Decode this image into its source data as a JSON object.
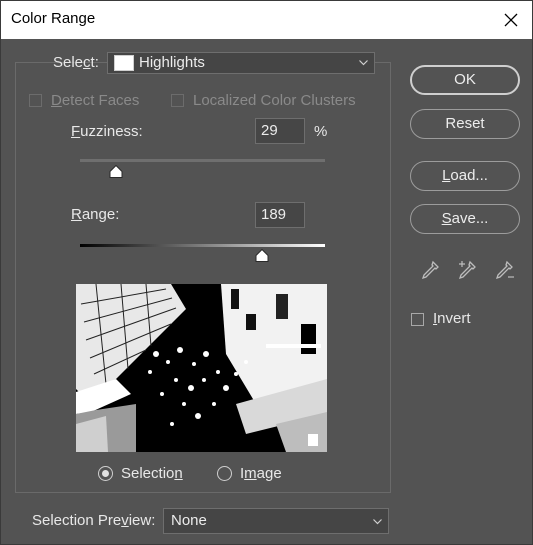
{
  "window": {
    "title": "Color Range"
  },
  "select": {
    "prefix": "Sele",
    "accel": "c",
    "suffix": "t:",
    "value": "Highlights"
  },
  "detect_faces": {
    "pre": "",
    "accel": "D",
    "post": "etect Faces",
    "checked": false,
    "enabled": false
  },
  "localized": {
    "label": "Localized Color Clusters",
    "checked": false,
    "enabled": false
  },
  "fuzziness": {
    "accel": "F",
    "rest": "uzziness:",
    "value": "29",
    "unit": "%"
  },
  "range": {
    "accel": "R",
    "rest": "ange:",
    "value": "189"
  },
  "buttons": {
    "ok": "OK",
    "reset": "Reset",
    "load": {
      "accel": "L",
      "rest": "oad..."
    },
    "save": {
      "accel": "S",
      "rest": "ave..."
    }
  },
  "eyedroppers": [
    "eyedropper-icon",
    "eyedropper-add-icon",
    "eyedropper-subtract-icon"
  ],
  "invert": {
    "accel": "I",
    "rest": "nvert",
    "checked": false
  },
  "view_mode": {
    "selection": {
      "pre": "Selectio",
      "accel": "n",
      "post": "",
      "selected": true
    },
    "image": {
      "pre": "I",
      "accel": "m",
      "post": "age",
      "selected": false
    }
  },
  "selection_preview": {
    "pre": "Selection Pre",
    "accel": "v",
    "post": "iew:",
    "value": "None"
  },
  "colors": {
    "bg": "#535353",
    "text": "#e8e8e8",
    "disabled": "#8a8a8a",
    "field": "#454545"
  }
}
